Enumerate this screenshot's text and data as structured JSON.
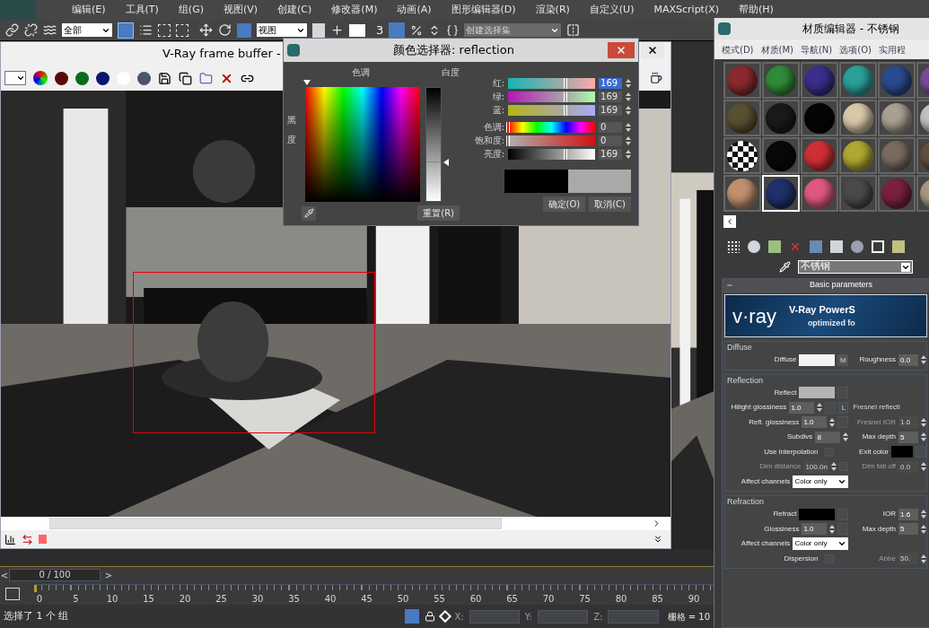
{
  "menu_bar": {
    "items": [
      "编辑(E)",
      "工具(T)",
      "组(G)",
      "视图(V)",
      "创建(C)",
      "修改器(M)",
      "动画(A)",
      "图形编辑器(D)",
      "渲染(R)",
      "自定义(U)",
      "MAXScript(X)",
      "帮助(H)"
    ]
  },
  "main_toolbar": {
    "selection_filter": "全部",
    "reference_coordinate": "视图",
    "angle_snap": "3",
    "named_selection": "创建选择集"
  },
  "frame_buffer": {
    "title": "V-Ray frame buffer -",
    "channels": [
      {
        "color": "#5a0808"
      },
      {
        "color": "#0b6a1e"
      },
      {
        "color": "#0a1670"
      },
      {
        "color": "#ffffff"
      }
    ]
  },
  "color_picker": {
    "title": "颜色选择器: reflection",
    "hue_label": "色调",
    "blackness_label": "黑度",
    "whiteness": {
      "label": "白度",
      "level": 0.66
    },
    "channels": [
      {
        "kind": "red",
        "label": "红:",
        "value": "169",
        "level": 0.663,
        "selected": true
      },
      {
        "kind": "green",
        "label": "绿:",
        "value": "169",
        "level": 0.663,
        "selected": false
      },
      {
        "kind": "blue",
        "label": "蓝:",
        "value": "169",
        "level": 0.663,
        "selected": false
      },
      {
        "kind": "hue",
        "label": "色调:",
        "value": "0",
        "level": 0,
        "selected": false
      },
      {
        "kind": "saturation",
        "label": "饱和度:",
        "value": "0",
        "level": 0,
        "selected": false
      },
      {
        "kind": "value",
        "label": "亮度:",
        "value": "169",
        "level": 0.663,
        "selected": false
      }
    ],
    "swatches": [
      {
        "color": "#000000"
      },
      {
        "color": "#a9a9a9"
      }
    ],
    "reset": "重置(R)",
    "ok": "确定(O)",
    "cancel": "取消(C)"
  },
  "material_editor": {
    "title": "材质编辑器 - 不锈钢",
    "menu": [
      "模式(D)",
      "材质(M)",
      "导航(N)",
      "选项(O)",
      "实用程"
    ],
    "slots": [
      {
        "kind": "sphere",
        "color": "#8a2a2e",
        "selected": false
      },
      {
        "kind": "sphere",
        "color": "#2f8a3a",
        "selected": false
      },
      {
        "kind": "sphere",
        "color": "#3a2f8a",
        "selected": false
      },
      {
        "kind": "sphere",
        "color": "#2aa09a",
        "selected": false
      },
      {
        "kind": "sphere",
        "color": "#2c4a90",
        "selected": false
      },
      {
        "kind": "sphere",
        "color": "#7a4a9a",
        "selected": false
      },
      {
        "kind": "sphere",
        "color": "#5a5030",
        "selected": false
      },
      {
        "kind": "sphere",
        "color": "#1a1a1a",
        "selected": false
      },
      {
        "kind": "sphere",
        "color": "#050505",
        "selected": false
      },
      {
        "kind": "sphere",
        "color": "#d8c8a8",
        "selected": false
      },
      {
        "kind": "sphere",
        "color": "#a8a090",
        "selected": false
      },
      {
        "kind": "sphere",
        "color": "#c0c0c0",
        "selected": false
      },
      {
        "kind": "checker",
        "color": "#ffffff",
        "selected": false
      },
      {
        "kind": "sphere",
        "color": "#080808",
        "selected": false
      },
      {
        "kind": "sphere",
        "color": "#d03034",
        "selected": false
      },
      {
        "kind": "sphere",
        "color": "#b0a830",
        "selected": false
      },
      {
        "kind": "sphere",
        "color": "#7a6a60",
        "selected": false
      },
      {
        "kind": "sphere",
        "color": "#605040",
        "selected": false
      },
      {
        "kind": "sphere",
        "color": "#c09070",
        "selected": false
      },
      {
        "kind": "sphere",
        "color": "#20306a",
        "selected": true
      },
      {
        "kind": "sphere",
        "color": "#e05880",
        "selected": false
      },
      {
        "kind": "sphere",
        "color": "#4a4a4a",
        "selected": false
      },
      {
        "kind": "sphere",
        "color": "#7a2040",
        "selected": false
      },
      {
        "kind": "sphere",
        "color": "#a89880",
        "selected": false
      }
    ],
    "material_name": "不锈钢",
    "rollout": "Basic parameters",
    "banner": {
      "logo": "v·ray",
      "title": "V-Ray PowerS",
      "subtitle": "optimized fo"
    },
    "groups": [
      {
        "title": "Diffuse",
        "rows": [
          {
            "left": {
              "kind": "swatch",
              "label": "Diffuse",
              "color": "#f4f4f4",
              "map": "M"
            },
            "right": {
              "kind": "spinner",
              "label": "Roughness",
              "value": "0.0",
              "disabled": false
            }
          }
        ]
      },
      {
        "title": "Reflection",
        "rows": [
          {
            "left": {
              "kind": "swatch",
              "label": "Reflect",
              "color": "#b4b4b4"
            }
          },
          {
            "left": {
              "kind": "spinner",
              "label": "Hilight glossiness",
              "value": "1.0",
              "disabled": false,
              "map": true,
              "lock": "L"
            },
            "right": {
              "kind": "text",
              "label": "Fresnel reflecti"
            }
          },
          {
            "left": {
              "kind": "spinner",
              "label": "Refl. glossiness",
              "value": "1.0",
              "disabled": false,
              "map": true
            },
            "right": {
              "kind": "spinner",
              "label": "Fresnel IOR",
              "value": "1.6",
              "disabled": true
            }
          },
          {
            "left": {
              "kind": "spinner",
              "label": "Subdivs",
              "value": "8",
              "disabled": false
            },
            "right": {
              "kind": "spinner",
              "label": "Max depth",
              "value": "5",
              "disabled": false
            }
          },
          {
            "left": {
              "kind": "checkbox",
              "label": "Use interpolation",
              "checked": false
            },
            "right": {
              "kind": "swatch",
              "label": "Exit color",
              "color": "#000000"
            }
          },
          {
            "left": {
              "kind": "spinner",
              "label": "Dim distance",
              "value": "100.0n",
              "disabled": true,
              "checked": false
            },
            "right": {
              "kind": "spinner",
              "label": "Dim fall off",
              "value": "0.0",
              "disabled": true
            }
          },
          {
            "left": {
              "kind": "dropdown",
              "label": "Affect channels",
              "value": "Color only"
            }
          }
        ]
      },
      {
        "title": "Refraction",
        "rows": [
          {
            "left": {
              "kind": "swatch",
              "label": "Refract",
              "color": "#000000"
            },
            "right": {
              "kind": "spinner",
              "label": "IOR",
              "value": "1.6",
              "disabled": false
            }
          },
          {
            "left": {
              "kind": "spinner",
              "label": "Glossiness",
              "value": "1.0",
              "disabled": false,
              "map": true
            },
            "right": {
              "kind": "spinner",
              "label": "Max depth",
              "value": "5",
              "disabled": false
            }
          },
          {
            "left": {
              "kind": "dropdown",
              "label": "Affect channels",
              "value": "Color only"
            }
          },
          {
            "left": {
              "kind": "checkbox",
              "label": "Dispersion",
              "checked": false
            },
            "right": {
              "kind": "spinner",
              "label": "Abbe",
              "value": "50.",
              "disabled": true
            }
          }
        ]
      }
    ]
  },
  "timeline": {
    "frame": "0 / 100",
    "level": 0,
    "prev": "<",
    "next": ">",
    "ticks": [
      "0",
      "5",
      "10",
      "15",
      "20",
      "25",
      "30",
      "35",
      "40",
      "45",
      "50",
      "55",
      "60",
      "65",
      "70",
      "75",
      "80",
      "85",
      "90"
    ]
  },
  "status_bar": {
    "message": "选择了 1 个 组",
    "x_label": "X:",
    "y_label": "Y:",
    "z_label": "Z:",
    "grid": "栅格 = 10"
  }
}
